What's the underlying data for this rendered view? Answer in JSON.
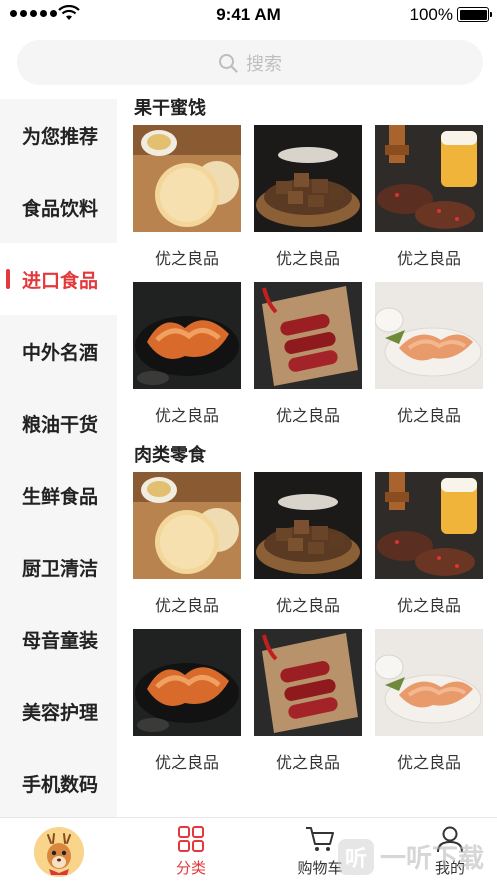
{
  "status_bar": {
    "time": "9:41 AM",
    "battery": "100%"
  },
  "search": {
    "placeholder": "搜索"
  },
  "sidebar": {
    "items": [
      {
        "label": "为您推荐"
      },
      {
        "label": "食品饮料"
      },
      {
        "label": "进口食品",
        "active": true
      },
      {
        "label": "中外名酒"
      },
      {
        "label": "粮油干货"
      },
      {
        "label": "生鲜食品"
      },
      {
        "label": "厨卫清洁"
      },
      {
        "label": "母音童装"
      },
      {
        "label": "美容护理"
      },
      {
        "label": "手机数码"
      }
    ]
  },
  "sections": [
    {
      "title": "果干蜜饯",
      "products": [
        {
          "name": "优之良品",
          "image": "rice-cracker-photo"
        },
        {
          "name": "优之良品",
          "image": "beef-cubes-photo"
        },
        {
          "name": "优之良品",
          "image": "jerky-beer-photo"
        },
        {
          "name": "优之良品",
          "image": "spicy-strips-photo"
        },
        {
          "name": "优之良品",
          "image": "sausage-photo"
        },
        {
          "name": "优之良品",
          "image": "dried-shreds-photo"
        }
      ]
    },
    {
      "title": "肉类零食",
      "products": [
        {
          "name": "优之良品",
          "image": "rice-cracker-photo"
        },
        {
          "name": "优之良品",
          "image": "beef-cubes-photo"
        },
        {
          "name": "优之良品",
          "image": "jerky-beer-photo"
        },
        {
          "name": "优之良品",
          "image": "spicy-strips-photo"
        },
        {
          "name": "优之良品",
          "image": "sausage-photo"
        },
        {
          "name": "优之良品",
          "image": "dried-shreds-photo"
        }
      ]
    }
  ],
  "tabbar": {
    "items": [
      {
        "label": "",
        "icon": "deer-avatar-icon"
      },
      {
        "label": "分类",
        "icon": "grid-icon",
        "active": true
      },
      {
        "label": "购物车",
        "icon": "cart-icon"
      },
      {
        "label": "我的",
        "icon": "user-icon"
      }
    ]
  },
  "watermark": {
    "text": "一听下载",
    "icon_text": "听"
  },
  "colors": {
    "accent": "#e4393c",
    "sidebar_bg": "#f6f6f6",
    "search_bg": "#f5f5f5"
  }
}
